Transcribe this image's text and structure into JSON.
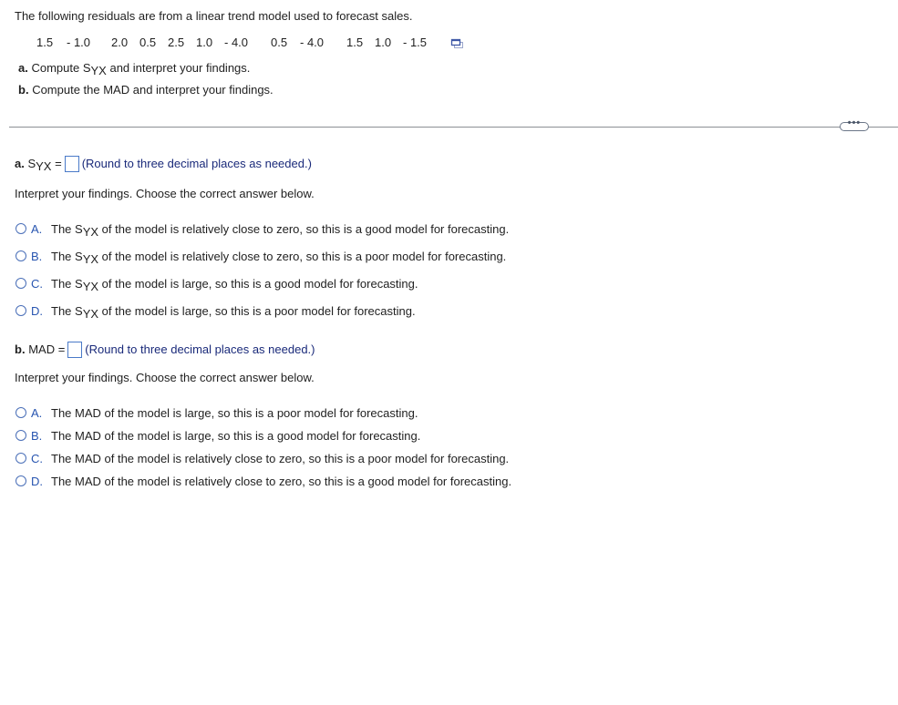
{
  "question": {
    "intro": "The following residuals are from a linear trend model used to forecast sales.",
    "residuals": [
      "1.5",
      "- 1.0",
      "2.0",
      "0.5",
      "2.5",
      "1.0",
      "- 4.0",
      "0.5",
      "- 4.0",
      "1.5",
      "1.0",
      "- 1.5"
    ],
    "copy_icon": "copy-data-icon",
    "tasks": [
      {
        "letter": "a.",
        "pre": "Compute S",
        "sub": "YX",
        "post": " and interpret your findings."
      },
      {
        "letter": "b.",
        "pre": "Compute the MAD and interpret your findings.",
        "sub": "",
        "post": ""
      }
    ]
  },
  "more_button": {
    "label": "•••",
    "icon": "more-options-icon"
  },
  "part_a": {
    "label_letter": "a.",
    "label_symbol": "S",
    "label_sub": "YX",
    "equals": "=",
    "answer_value": "",
    "hint": "(Round to three decimal places as needed.)",
    "prompt": "Interpret your findings. Choose the correct answer below.",
    "options": [
      {
        "letter": "A.",
        "pre": "The S",
        "sub": "YX",
        "post": " of the model is relatively close to zero, so this is a good model for forecasting."
      },
      {
        "letter": "B.",
        "pre": "The S",
        "sub": "YX",
        "post": " of the model is relatively close to zero, so this is a poor model for forecasting."
      },
      {
        "letter": "C.",
        "pre": "The S",
        "sub": "YX",
        "post": " of the model is large, so this is a good model for forecasting."
      },
      {
        "letter": "D.",
        "pre": "The S",
        "sub": "YX",
        "post": " of the model is large, so this is a poor model for forecasting."
      }
    ]
  },
  "part_b": {
    "label_letter": "b.",
    "label_text": "MAD =",
    "answer_value": "",
    "hint": "(Round to three decimal places as needed.)",
    "prompt": "Interpret your findings. Choose the correct answer below.",
    "options": [
      {
        "letter": "A.",
        "text": "The MAD of the model is large, so this is a poor model for forecasting."
      },
      {
        "letter": "B.",
        "text": "The MAD of the model is large, so this is a good model for forecasting."
      },
      {
        "letter": "C.",
        "text": "The MAD of the model is relatively close to zero, so this is a poor model for forecasting."
      },
      {
        "letter": "D.",
        "text": "The MAD of the model is relatively close to zero, so this is a good model for forecasting."
      }
    ]
  },
  "colors": {
    "option_letter": "#2855b0",
    "hint_text": "#1a2a7a",
    "input_border": "#4a7ac8",
    "divider": "#8c8f94"
  }
}
